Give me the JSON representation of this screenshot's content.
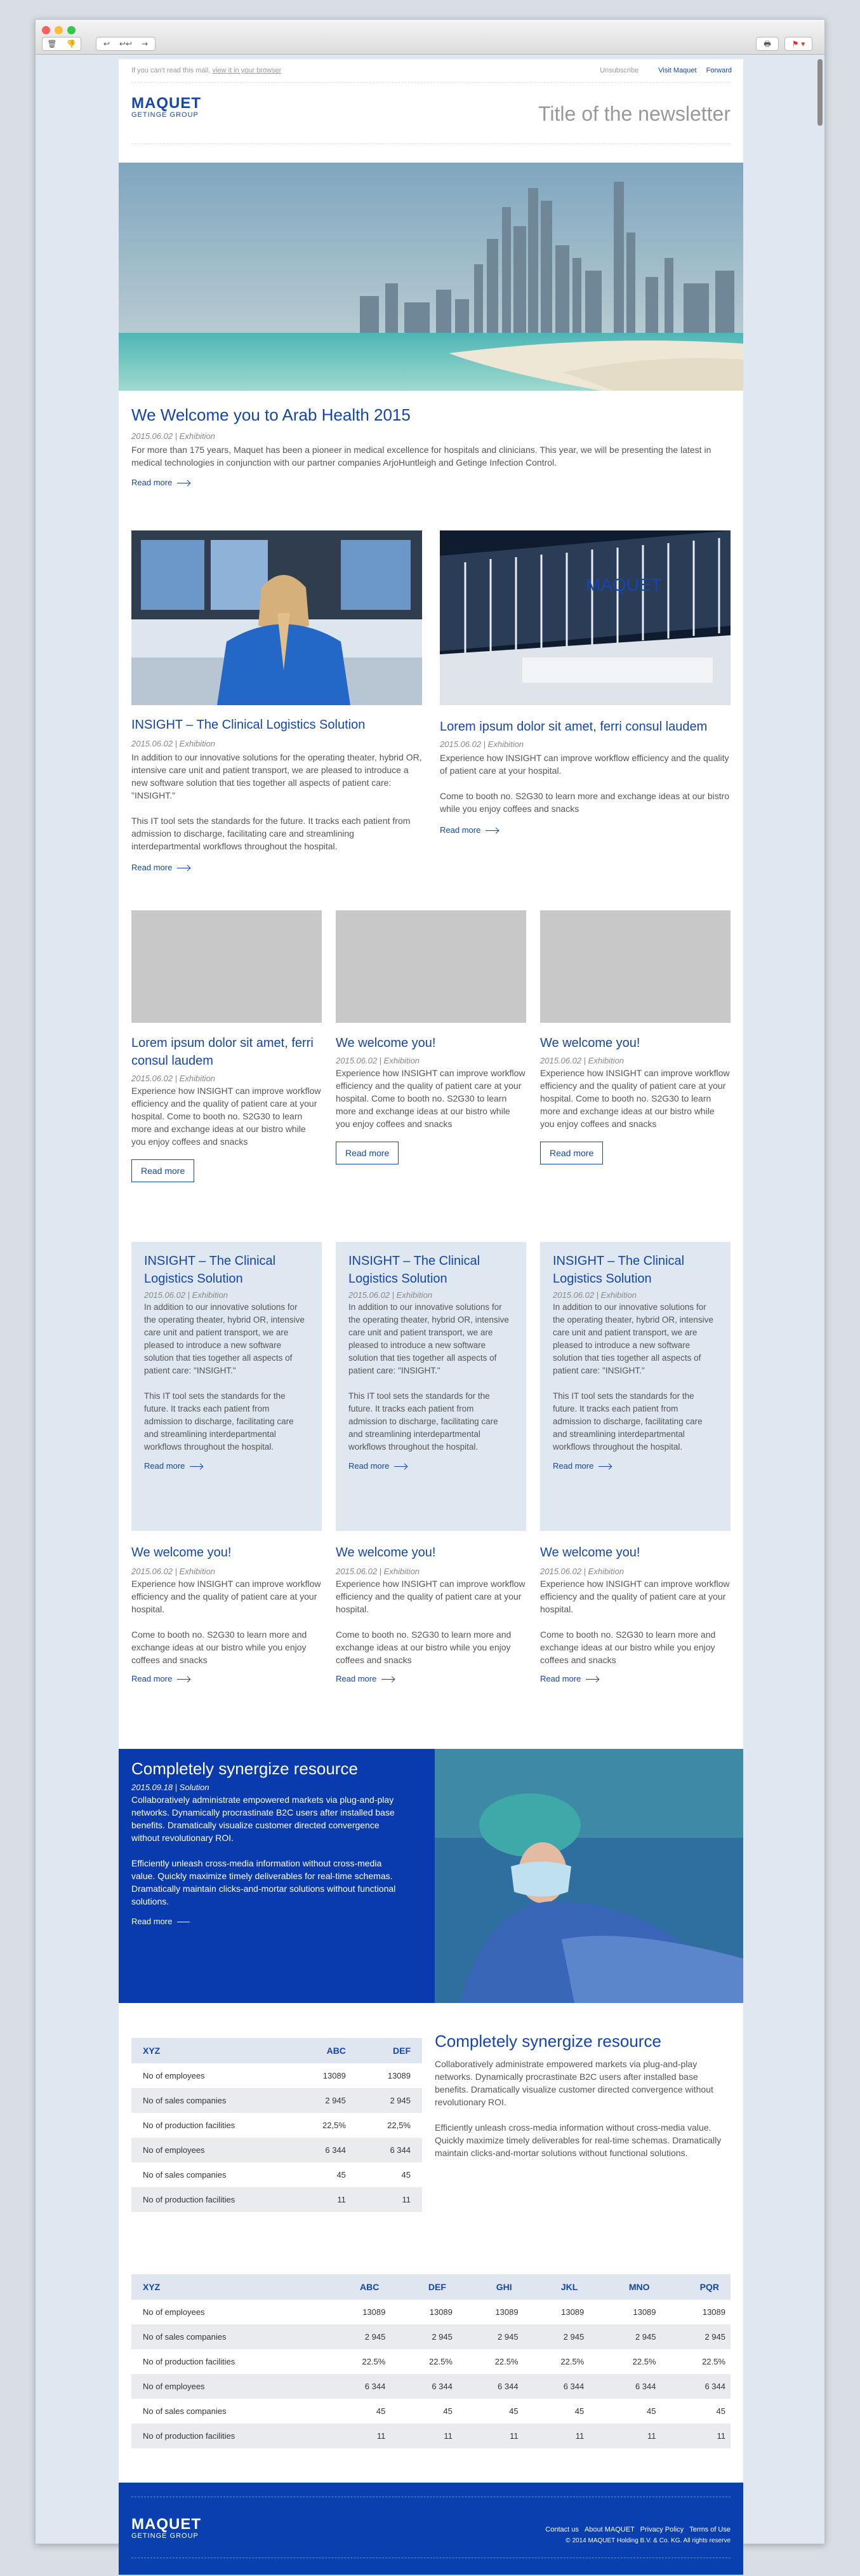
{
  "toolbar": {
    "buttons": [
      "🗑",
      "👎",
      "↩",
      "↩↩",
      "→"
    ],
    "print": "🖶",
    "flag": "⚑ ▾"
  },
  "colors": {
    "brand": "#1446ad",
    "footer": "#0a3fb0",
    "dark_panel": "#0a3bae"
  },
  "header": {
    "cant_read": "If you can't read this mail,",
    "view_link": "view it in your browser",
    "links": [
      "Unsubscribe",
      "Visit Maquet",
      "Forward"
    ],
    "logo_main": "MAQUET",
    "logo_sub": "GETINGE GROUP",
    "newsletter_title": "Title of the newsletter"
  },
  "hero": {
    "title": "We Welcome you to Arab Health 2015",
    "meta": "2015.06.02 | Exhibition",
    "body": "For more than 175 years, Maquet has been a pioneer in medical excellence for hospitals and clinicians. This year, we will be presenting the latest in medical technologies in conjunction with our partner companies ArjoHuntleigh and Getinge Infection Control.",
    "read_more": "Read more"
  },
  "two_col": [
    {
      "title": "INSIGHT – The Clinical Logistics Solution",
      "meta": "2015.06.02 | Exhibition",
      "p1": "In addition to our innovative solutions for the operating theater, hybrid OR, intensive care unit and patient transport, we are pleased to introduce a new software solution that ties together all aspects of patient care: \"INSIGHT.\"",
      "p2": "This IT tool sets the standards for the future. It tracks each patient from admission to discharge, facilitating care and streamlining interdepartmental workflows throughout the hospital.",
      "read_more": "Read more"
    },
    {
      "title": "Lorem ipsum dolor sit amet, ferri consul laudem",
      "meta": "2015.06.02 | Exhibition",
      "p1": "Experience how INSIGHT can improve workflow efficiency and the quality of patient care at your hospital.",
      "p2": "Come to booth no. S2G30 to learn more and exchange ideas at our bistro while you enjoy coffees and snacks",
      "read_more": "Read more",
      "booth_sign": "MAQUET"
    }
  ],
  "three_col": [
    {
      "title": "Lorem ipsum dolor sit amet, ferri consul laudem",
      "meta": "2015.06.02 | Exhibition",
      "body": "Experience how INSIGHT can improve workflow efficiency and the quality of patient care at your hospital. Come to booth no. S2G30 to learn more and exchange ideas at our bistro while you enjoy coffees and snacks",
      "button": "Read more"
    },
    {
      "title": "We welcome you!",
      "meta": "2015.06.02 | Exhibition",
      "body": "Experience how INSIGHT can improve workflow efficiency and the quality of patient care at your hospital. Come to booth no. S2G30 to learn more and exchange ideas at our bistro while you enjoy coffees and snacks",
      "button": "Read more"
    },
    {
      "title": "We welcome you!",
      "meta": "2015.06.02 | Exhibition",
      "body": "Experience how INSIGHT can improve workflow efficiency and the quality of patient care at your hospital. Come to booth no. S2G30 to learn more and exchange ideas at our bistro while you enjoy coffees and snacks",
      "button": "Read more"
    }
  ],
  "boxed": [
    {
      "title": "INSIGHT – The Clinical Logistics Solution",
      "meta": "2015.06.02 | Exhibition",
      "p1": "In addition to our innovative solutions for the operating theater, hybrid OR, intensive care unit and patient transport, we are pleased to introduce a new software solution that ties together all aspects of patient care: \"INSIGHT.\"",
      "p2": "This IT tool sets the standards for the future. It tracks each patient from admission to discharge, facilitating care and streamlining interdepartmental workflows throughout the hospital.",
      "read_more": "Read more"
    },
    {
      "title": "INSIGHT – The Clinical Logistics Solution",
      "meta": "2015.06.02 | Exhibition",
      "p1": "In addition to our innovative solutions for the operating theater, hybrid OR, intensive care unit and patient transport, we are pleased to introduce a new software solution that ties together all aspects of patient care: \"INSIGHT.\"",
      "p2": "This IT tool sets the standards for the future. It tracks each patient from admission to discharge, facilitating care and streamlining interdepartmental workflows throughout the hospital.",
      "read_more": "Read more"
    },
    {
      "title": "INSIGHT – The Clinical Logistics Solution",
      "meta": "2015.06.02 | Exhibition",
      "p1": "In addition to our innovative solutions for the operating theater, hybrid OR, intensive care unit and patient transport, we are pleased to introduce a new software solution that ties together all aspects of patient care: \"INSIGHT.\"",
      "p2": "This IT tool sets the standards for the future. It tracks each patient from admission to discharge, facilitating care and streamlining interdepartmental workflows throughout the hospital.",
      "read_more": "Read more"
    }
  ],
  "welcome": [
    {
      "title": "We welcome you!",
      "meta": "2015.06.02 | Exhibition",
      "p1": "Experience how INSIGHT can improve workflow efficiency and the quality of patient care at your hospital.",
      "p2": "Come to booth no. S2G30 to learn more and exchange ideas at our bistro while you enjoy coffees and snacks",
      "read_more": "Read more"
    },
    {
      "title": "We welcome you!",
      "meta": "2015.06.02 | Exhibition",
      "p1": "Experience how INSIGHT can improve workflow efficiency and the quality of patient care at your hospital.",
      "p2": "Come to booth no. S2G30 to learn more and exchange ideas at our bistro while you enjoy coffees and snacks",
      "read_more": "Read more"
    },
    {
      "title": "We welcome you!",
      "meta": "2015.06.02 | Exhibition",
      "p1": "Experience how INSIGHT can improve workflow efficiency and the quality of patient care at your hospital.",
      "p2": "Come to booth no. S2G30 to learn more and exchange ideas at our bistro while you enjoy coffees and snacks",
      "read_more": "Read more"
    }
  ],
  "feature": {
    "title": "Completely synergize resource",
    "meta": "2015.09.18 | Solution",
    "p1": "Collaboratively administrate empowered markets via plug-and-play networks. Dynamically procrastinate B2C users after installed base benefits. Dramatically visualize customer directed convergence without revolutionary ROI.",
    "p2": "Efficiently unleash cross-media information without cross-media value. Quickly maximize timely deliverables for real-time schemas. Dramatically maintain clicks-and-mortar solutions without functional solutions.",
    "read_more": "Read more"
  },
  "table_small": {
    "headers": [
      "XYZ",
      "ABC",
      "DEF"
    ],
    "rows": [
      [
        "No of employees",
        "13089",
        "13089"
      ],
      [
        "No of sales companies",
        "2 945",
        "2 945"
      ],
      [
        "No of production facilities",
        "22,5%",
        "22,5%"
      ],
      [
        "No of employees",
        "6 344",
        "6 344"
      ],
      [
        "No of sales companies",
        "45",
        "45"
      ],
      [
        "No of production facilities",
        "11",
        "11"
      ]
    ]
  },
  "side_text": {
    "title": "Completely synergize resource",
    "p1": "Collaboratively administrate empowered markets via plug-and-play networks. Dynamically procrastinate B2C users after installed base benefits. Dramatically visualize customer directed convergence without revolutionary ROI.",
    "p2": "Efficiently unleash cross-media information without cross-media value. Quickly maximize timely deliverables for real-time schemas. Dramatically maintain clicks-and-mortar solutions without functional solutions."
  },
  "table_big": {
    "headers": [
      "XYZ",
      "ABC",
      "DEF",
      "GHI",
      "JKL",
      "MNO",
      "PQR"
    ],
    "rows": [
      [
        "No of employees",
        "13089",
        "13089",
        "13089",
        "13089",
        "13089",
        "13089"
      ],
      [
        "No of sales companies",
        "2 945",
        "2 945",
        "2 945",
        "2 945",
        "2 945",
        "2 945"
      ],
      [
        "No of production facilities",
        "22.5%",
        "22.5%",
        "22.5%",
        "22.5%",
        "22.5%",
        "22.5%"
      ],
      [
        "No of employees",
        "6 344",
        "6 344",
        "6 344",
        "6 344",
        "6 344",
        "6 344"
      ],
      [
        "No of sales companies",
        "45",
        "45",
        "45",
        "45",
        "45",
        "45"
      ],
      [
        "No of production facilities",
        "11",
        "11",
        "11",
        "11",
        "11",
        "11"
      ]
    ]
  },
  "footer": {
    "logo_main": "MAQUET",
    "logo_sub": "GETINGE GROUP",
    "links": [
      "Contact us",
      "About MAQUET",
      "Privacy Policy",
      "Terms of Use"
    ],
    "copyright": "© 2014 MAQUET Holding B.V. & Co. KG. All rights reserve"
  }
}
